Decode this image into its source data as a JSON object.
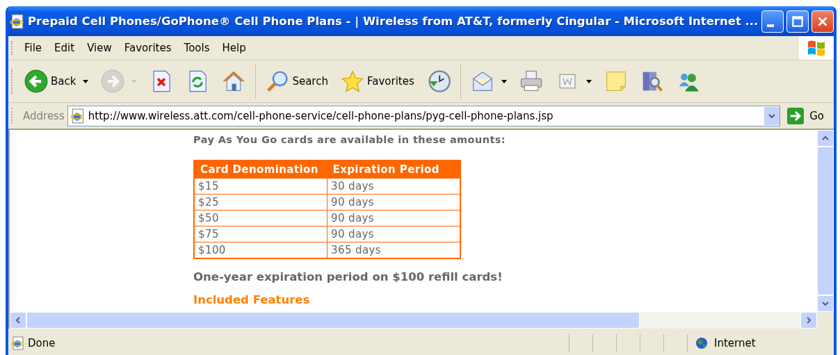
{
  "window": {
    "title": "Prepaid Cell Phones/GoPhone® Cell Phone Plans - | Wireless from AT&T, formerly Cingular - Microsoft Internet ..."
  },
  "menu": [
    {
      "label": "File"
    },
    {
      "label": "Edit"
    },
    {
      "label": "View"
    },
    {
      "label": "Favorites"
    },
    {
      "label": "Tools"
    },
    {
      "label": "Help"
    }
  ],
  "toolbar": [
    {
      "kind": "back",
      "label": "Back",
      "dropdown": true,
      "disabled": false
    },
    {
      "kind": "forward",
      "dropdown": true,
      "disabled": true
    },
    {
      "kind": "stop",
      "dropdown": false,
      "disabled": false
    },
    {
      "kind": "refresh",
      "dropdown": false,
      "disabled": false
    },
    {
      "kind": "home",
      "dropdown": false,
      "disabled": false
    },
    {
      "kind": "separator"
    },
    {
      "kind": "search",
      "label": "Search",
      "dropdown": false,
      "disabled": false
    },
    {
      "kind": "favorites",
      "label": "Favorites",
      "dropdown": false,
      "disabled": false
    },
    {
      "kind": "history",
      "dropdown": false,
      "disabled": false
    },
    {
      "kind": "separator"
    },
    {
      "kind": "mail",
      "dropdown": true,
      "disabled": false
    },
    {
      "kind": "print",
      "dropdown": false,
      "disabled": false
    },
    {
      "kind": "edit",
      "dropdown": true,
      "disabled": false
    },
    {
      "kind": "note",
      "dropdown": false,
      "disabled": false
    },
    {
      "kind": "research",
      "dropdown": false,
      "disabled": false
    },
    {
      "kind": "messenger",
      "dropdown": false,
      "disabled": false
    }
  ],
  "address_bar": {
    "label": "Address",
    "url": "http://www.wireless.att.com/cell-phone-service/cell-phone-plans/pyg-cell-phone-plans.jsp",
    "go": "Go"
  },
  "page": {
    "intro": "Pay As You Go cards are available in these amounts:",
    "table": {
      "columns": [
        "Card Denomination",
        "Expiration Period"
      ],
      "rows": [
        [
          "$15",
          "30 days"
        ],
        [
          "$25",
          "90 days"
        ],
        [
          "$50",
          "90 days"
        ],
        [
          "$75",
          "90 days"
        ],
        [
          "$100",
          "365 days"
        ]
      ]
    },
    "note": "One-year expiration period on $100 refill cards!",
    "section_heading": "Included Features"
  },
  "status_bar": {
    "text": "Done",
    "zone": "Internet"
  }
}
